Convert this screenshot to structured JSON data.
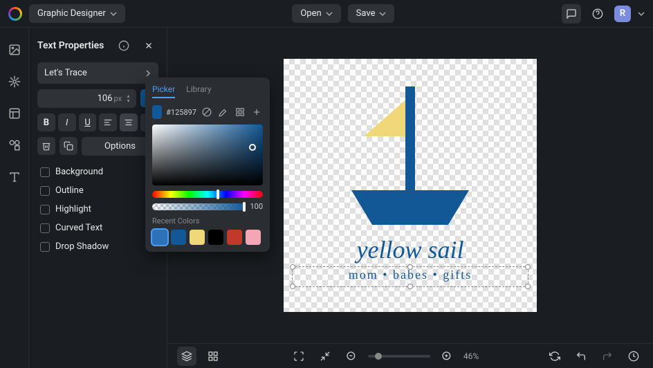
{
  "topbar": {
    "role_label": "Graphic Designer",
    "open_label": "Open",
    "save_label": "Save",
    "avatar_initial": "R"
  },
  "panel": {
    "title": "Text Properties",
    "font_family": "Let's Trace",
    "font_size": "106",
    "font_size_unit": "px",
    "options_label": "Options",
    "checks": {
      "background": "Background",
      "outline": "Outline",
      "highlight": "Highlight",
      "curved": "Curved Text",
      "shadow": "Drop Shadow"
    }
  },
  "picker": {
    "tab_picker": "Picker",
    "tab_library": "Library",
    "hex": "#125897",
    "alpha": "100",
    "recent_label": "Recent Colors",
    "recent": [
      "#2d72b8",
      "#125897",
      "#f0d87a",
      "#000000",
      "#c0392b",
      "#f4a6b4"
    ],
    "current_color": "#125897"
  },
  "artwork": {
    "title_text": "yellow sail",
    "subtitle_parts": [
      "mom",
      "babes",
      "gifts"
    ],
    "boat_hull_color": "#125897",
    "flag_color": "#f0d87a"
  },
  "bottombar": {
    "zoom_percent": "46%"
  }
}
